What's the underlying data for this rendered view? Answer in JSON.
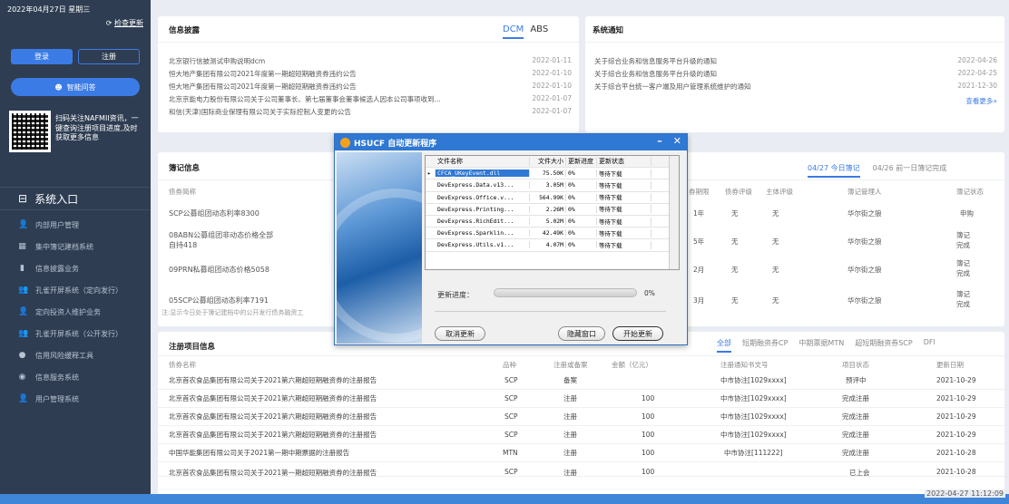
{
  "sidebar": {
    "date": "2022年04月27日 星期三",
    "check_icon": "refresh-icon",
    "check_update": "检查更新",
    "login": "登录",
    "register": "注册",
    "qa": "智能问答",
    "qr_text": "扫码关注NAFMII资讯，一键查询注册项目进度,及时获取更多信息",
    "entry": "系统入口",
    "menu": [
      {
        "icon": "user-icon",
        "glyph": "👤",
        "label": "内部用户管理"
      },
      {
        "icon": "grid-icon",
        "glyph": "▦",
        "label": "集中簿记建档系统"
      },
      {
        "icon": "chart-icon",
        "glyph": "▮",
        "label": "信息披露业务"
      },
      {
        "icon": "people-icon",
        "glyph": "👥",
        "label": "孔雀开屏系统（定向发行）"
      },
      {
        "icon": "investor-icon",
        "glyph": "👤",
        "label": "定向投资人维护业务"
      },
      {
        "icon": "people-icon",
        "glyph": "👥",
        "label": "孔雀开屏系统（公开发行）"
      },
      {
        "icon": "risk-icon",
        "glyph": "●",
        "label": "信用风险缓释工具"
      },
      {
        "icon": "service-icon",
        "glyph": "◉",
        "label": "信息服务系统"
      },
      {
        "icon": "user-icon",
        "glyph": "👤",
        "label": "用户管理系统"
      }
    ]
  },
  "disclosure": {
    "title": "信息披露",
    "tabs": [
      "DCM",
      "ABS"
    ],
    "rows": [
      {
        "text": "北京银行信披测试申购说明dcm",
        "date": "2022-01-11"
      },
      {
        "text": "恒大地产集团有限公司2021年度第一期超短期融资券违约公告",
        "date": "2022-01-10"
      },
      {
        "text": "恒大地产集团有限公司2021年度第一期超短期融资券违约公告",
        "date": "2022-01-10"
      },
      {
        "text": "北京京能电力股份有限公司关于公司董事长、第七届董事会董事候选人因本公司事项收到...",
        "date": "2022-01-07"
      },
      {
        "text": "和信(天津)国际商业保理有限公司关于实际控制人变更的公告",
        "date": "2022-01-07"
      }
    ]
  },
  "notice": {
    "title": "系统通知",
    "rows": [
      {
        "text": "关于综合业务和信息服务平台升级的通知",
        "date": "2022-04-26"
      },
      {
        "text": "关于综合业务和信息服务平台升级的通知",
        "date": "2022-04-25"
      },
      {
        "text": "关于综合平台统一客户端及用户管理系统维护的通知",
        "date": "2021-12-30"
      }
    ],
    "more": "查看更多»"
  },
  "bookkeeping": {
    "title": "簿记信息",
    "tabs": [
      "04/27 今日簿记",
      "04/26 前一日簿记完成"
    ],
    "headers": [
      "债券简称",
      "券期限",
      "债券评级",
      "主体评级",
      "簿记管理人",
      "簿记状态"
    ],
    "rows": [
      {
        "name": "SCP公募组团动态利率8300",
        "term": "1年",
        "bond": "无",
        "issuer": "无",
        "mgr": "华尔街之狼",
        "status": "申购"
      },
      {
        "name": "08ABN公募组团非动态价格全部自持418",
        "term": "5年",
        "bond": "无",
        "issuer": "无",
        "mgr": "华尔街之狼",
        "status": "簿记ership完成"
      },
      {
        "name": "09PRN私募组团动态价格5058",
        "term": "2月",
        "bond": "无",
        "issuer": "无",
        "mgr": "华尔街之狼",
        "status": "簿记ership完成"
      },
      {
        "name": "05SCP公募组团动态利率7191",
        "term": "3月",
        "bond": "无",
        "issuer": "无",
        "mgr": "华尔街之狼",
        "status": "簿记ership完成"
      }
    ],
    "note": "注:显示今日处于簿记建档中的公开发行债务融资工"
  },
  "registration": {
    "title": "注册项目信息",
    "tabs": [
      "全部",
      "短期融资券CP",
      "中期票据MTN",
      "超短期融资券SCP",
      "DFI"
    ],
    "headers": [
      "债券名称",
      "品种",
      "注册或备案",
      "金额（亿元）",
      "注册通知书文号",
      "项目状态",
      "更新日期"
    ],
    "rows": [
      {
        "name": "北京首农食品集团有限公司关于2021第六期超短期融资券的注册报告",
        "type": "SCP",
        "reg": "备案",
        "amt": "",
        "doc": "中市协注[1029xxxx]",
        "state": "预评中",
        "date": "2021-10-29"
      },
      {
        "name": "北京首农食品集团有限公司关于2021第六期超短期融资券的注册报告",
        "type": "SCP",
        "reg": "注册",
        "amt": "100",
        "doc": "中市协注[1029xxxx]",
        "state": "完成注册",
        "date": "2021-10-29"
      },
      {
        "name": "北京首农食品集团有限公司关于2021第六期超短期融资券的注册报告",
        "type": "SCP",
        "reg": "注册",
        "amt": "100",
        "doc": "中市协注[1029xxxx]",
        "state": "完成注册",
        "date": "2021-10-29"
      },
      {
        "name": "北京首农食品集团有限公司关于2021第六期超短期融资券的注册报告",
        "type": "SCP",
        "reg": "注册",
        "amt": "100",
        "doc": "中市协注[1029xxxx]",
        "state": "完成注册",
        "date": "2021-10-29"
      },
      {
        "name": "中国华能集团有限公司关于2021第一期中期票据的注册报告",
        "type": "MTN",
        "reg": "注册",
        "amt": "100",
        "doc": "中市协注[111222]",
        "state": "完成注册",
        "date": "2021-10-28"
      },
      {
        "name": "北京首农食品集团有限公司关于2021第一期超短期融资券的注册报告",
        "type": "SCP",
        "reg": "注册",
        "amt": "100",
        "doc": "",
        "state": "已上会",
        "date": "2021-10-28"
      }
    ]
  },
  "dialog": {
    "title": "HSUCF 自动更新程序",
    "headers": [
      "文件名称",
      "文件大小",
      "更新进度",
      "更新状态"
    ],
    "files": [
      {
        "name": "CFCA_UKeyEvent.dll",
        "size": "75.50K",
        "progress": "0%",
        "status": "等待下载"
      },
      {
        "name": "DevExpress.Data.v13...",
        "size": "3.05M",
        "progress": "0%",
        "status": "等待下载"
      },
      {
        "name": "DevExpress.Office.v...",
        "size": "564.99K",
        "progress": "0%",
        "status": "等待下载"
      },
      {
        "name": "DevExpress.Printing...",
        "size": "2.26M",
        "progress": "0%",
        "status": "等待下载"
      },
      {
        "name": "DevExpress.RichEdit...",
        "size": "5.02M",
        "progress": "0%",
        "status": "等待下载"
      },
      {
        "name": "DevExpress.Sparklin...",
        "size": "42.49K",
        "progress": "0%",
        "status": "等待下载"
      },
      {
        "name": "DevExpress.Utils.v1...",
        "size": "4.07M",
        "progress": "0%",
        "status": "等待下载"
      }
    ],
    "progress_label": "更新进度：",
    "progress_pct": "0%",
    "progress_value": 0,
    "cancel": "取消更新",
    "hide": "隐藏窗口",
    "start": "开始更新"
  },
  "footer_time": "2022-04-27 11:12:09"
}
